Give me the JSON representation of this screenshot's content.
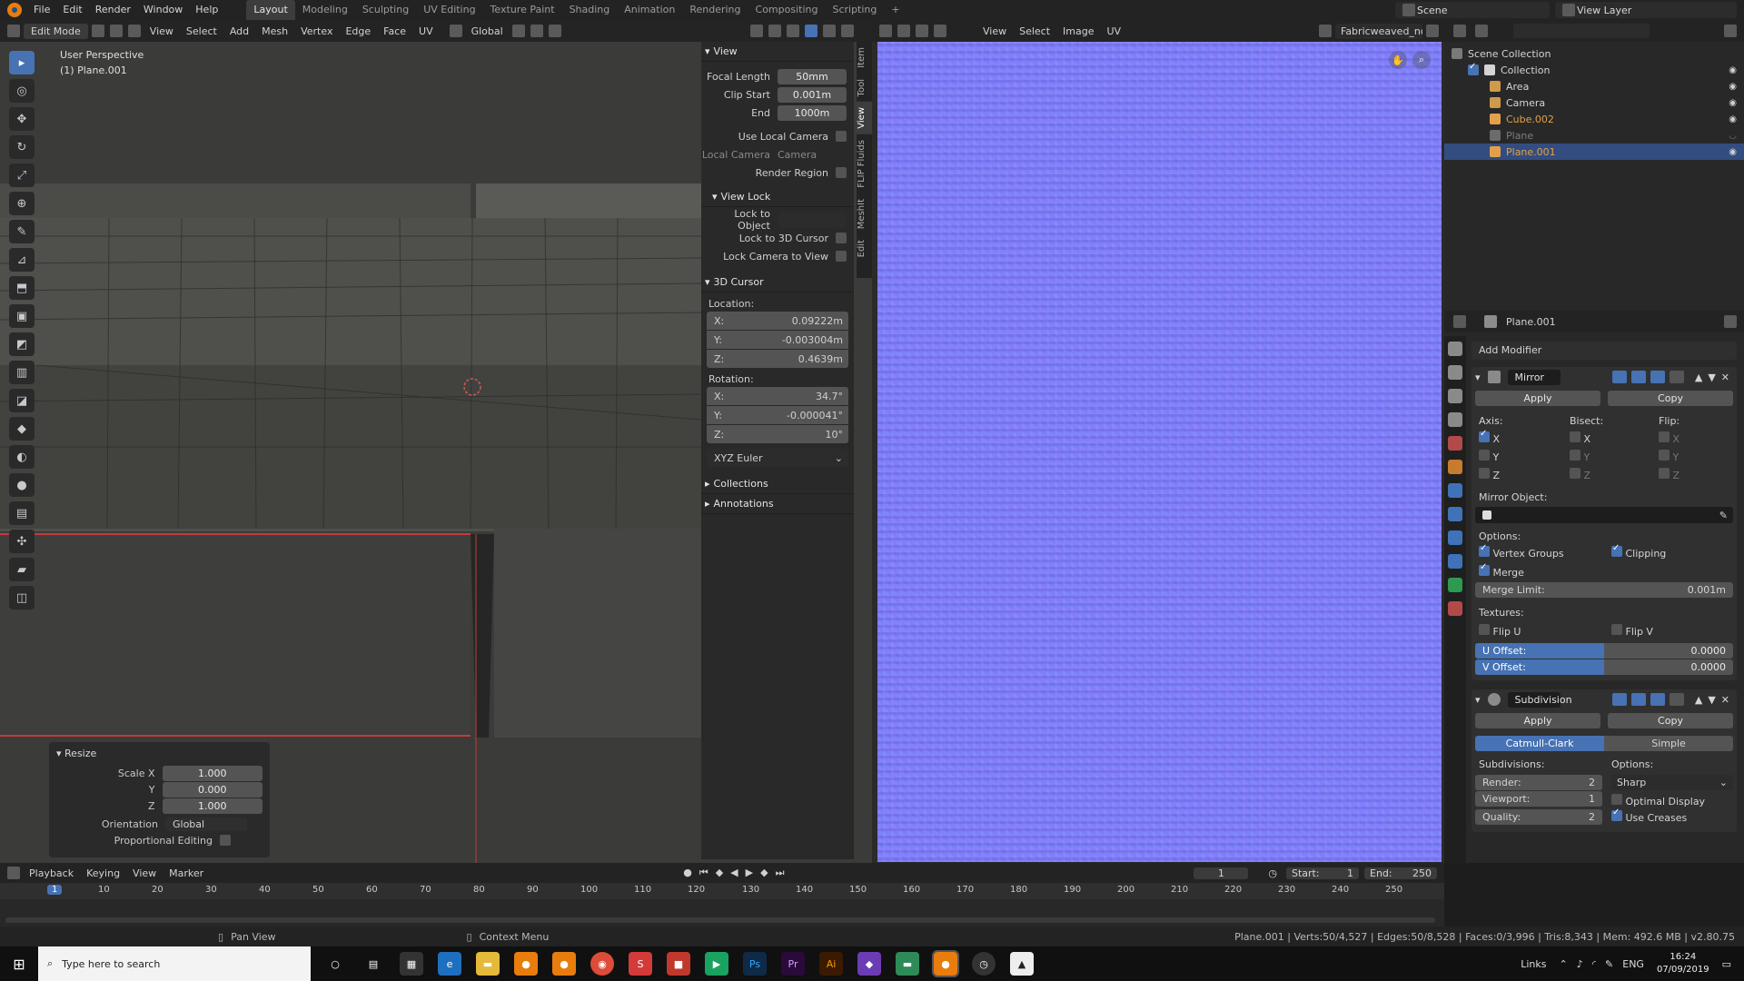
{
  "topbar": {
    "menus": [
      "File",
      "Edit",
      "Render",
      "Window",
      "Help"
    ],
    "workspaces": [
      "Layout",
      "Modeling",
      "Sculpting",
      "UV Editing",
      "Texture Paint",
      "Shading",
      "Animation",
      "Rendering",
      "Compositing",
      "Scripting"
    ],
    "active_workspace": "Layout",
    "add_tab": "+",
    "scene": "Scene",
    "view_layer": "View Layer"
  },
  "viewport_header": {
    "mode": "Edit Mode",
    "menus": [
      "View",
      "Select",
      "Add",
      "Mesh",
      "Vertex",
      "Edge",
      "Face",
      "UV"
    ],
    "orientation": "Global"
  },
  "viewport": {
    "perspective": "User Perspective",
    "object": "(1) Plane.001"
  },
  "resize_panel": {
    "title": "Resize",
    "scale_x_label": "Scale X",
    "scale_x": "1.000",
    "y_label": "Y",
    "y": "0.000",
    "z_label": "Z",
    "z": "1.000",
    "orientation_label": "Orientation",
    "orientation": "Global",
    "proportional_label": "Proportional Editing"
  },
  "npanel": {
    "tabs": [
      "Item",
      "Tool",
      "View",
      "FLIP Fluids",
      "MeshIt",
      "Edit"
    ],
    "view_title": "View",
    "focal_length_label": "Focal Length",
    "focal_length": "50mm",
    "clip_start_label": "Clip Start",
    "clip_start": "0.001m",
    "end_label": "End",
    "end": "1000m",
    "use_local_camera": "Use Local Camera",
    "local_camera_label": "Local Camera",
    "local_camera": "Camera",
    "render_region": "Render Region",
    "view_lock_title": "View Lock",
    "lock_to_object": "Lock to Object",
    "lock_to_3d_cursor": "Lock to 3D Cursor",
    "lock_camera_to_view": "Lock Camera to View",
    "cursor_title": "3D Cursor",
    "location_label": "Location:",
    "loc_x_label": "X:",
    "loc_x": "0.09222m",
    "loc_y_label": "Y:",
    "loc_y": "-0.003004m",
    "loc_z_label": "Z:",
    "loc_z": "0.4639m",
    "rotation_label": "Rotation:",
    "rot_x_label": "X:",
    "rot_x": "34.7°",
    "rot_y_label": "Y:",
    "rot_y": "-0.000041°",
    "rot_z_label": "Z:",
    "rot_z": "10°",
    "euler": "XYZ Euler",
    "collections": "Collections",
    "annotations": "Annotations"
  },
  "image_editor": {
    "menus": [
      "View",
      "Select",
      "Image",
      "UV"
    ],
    "image_name": "Fabricweaved_nor..."
  },
  "outliner": {
    "root": "Scene Collection",
    "collection": "Collection",
    "items": [
      {
        "name": "Area",
        "color": "#d0d0d0"
      },
      {
        "name": "Camera",
        "color": "#d0d0d0"
      },
      {
        "name": "Cube.002",
        "color": "#e3a04a"
      },
      {
        "name": "Plane",
        "color": "#7d7d7d"
      },
      {
        "name": "Plane.001",
        "color": "#e3a04a"
      }
    ]
  },
  "properties": {
    "object_name": "Plane.001",
    "add_modifier": "Add Modifier",
    "mirror": {
      "name": "Mirror",
      "apply": "Apply",
      "copy": "Copy",
      "axis_label": "Axis:",
      "bisect_label": "Bisect:",
      "flip_label": "Flip:",
      "x": "X",
      "y": "Y",
      "z": "Z",
      "mirror_object_label": "Mirror Object:",
      "options_label": "Options:",
      "vertex_groups": "Vertex Groups",
      "clipping": "Clipping",
      "merge": "Merge",
      "merge_limit_label": "Merge Limit:",
      "merge_limit": "0.001m",
      "textures_label": "Textures:",
      "flip_u": "Flip U",
      "flip_v": "Flip V",
      "u_offset_label": "U Offset:",
      "u_offset": "0.0000",
      "v_offset_label": "V Offset:",
      "v_offset": "0.0000"
    },
    "subdivision": {
      "name": "Subdivision",
      "apply": "Apply",
      "copy": "Copy",
      "catmull": "Catmull-Clark",
      "simple": "Simple",
      "subdivisions_label": "Subdivisions:",
      "options_label": "Options:",
      "render_label": "Render:",
      "render": "2",
      "viewport_label": "Viewport:",
      "viewport": "1",
      "quality_label": "Quality:",
      "quality": "2",
      "sharp": "Sharp",
      "optimal_display": "Optimal Display",
      "use_creases": "Use Creases"
    }
  },
  "timeline": {
    "menus": [
      "Playback",
      "Keying",
      "View",
      "Marker"
    ],
    "current_frame": "1",
    "start_label": "Start:",
    "start": "1",
    "end_label": "End:",
    "end": "250",
    "ticks": [
      "1",
      "10",
      "20",
      "30",
      "40",
      "50",
      "60",
      "70",
      "80",
      "90",
      "100",
      "110",
      "120",
      "130",
      "140",
      "150",
      "160",
      "170",
      "180",
      "190",
      "200",
      "210",
      "220",
      "230",
      "240",
      "250"
    ]
  },
  "statusbar": {
    "pan_view": "Pan View",
    "context_menu": "Context Menu",
    "stats": "Plane.001 | Verts:50/4,527 | Edges:50/8,528 | Faces:0/3,996 | Tris:8,343 | Mem: 492.6 MB | v2.80.75"
  },
  "taskbar": {
    "search_placeholder": "Type here to search",
    "links": "Links",
    "lang": "ENG",
    "time": "16:24",
    "date": "07/09/2019"
  },
  "colors": {
    "accent": "#4772b3",
    "normal_map": "#8181f4",
    "selected_row": "#334d80"
  }
}
